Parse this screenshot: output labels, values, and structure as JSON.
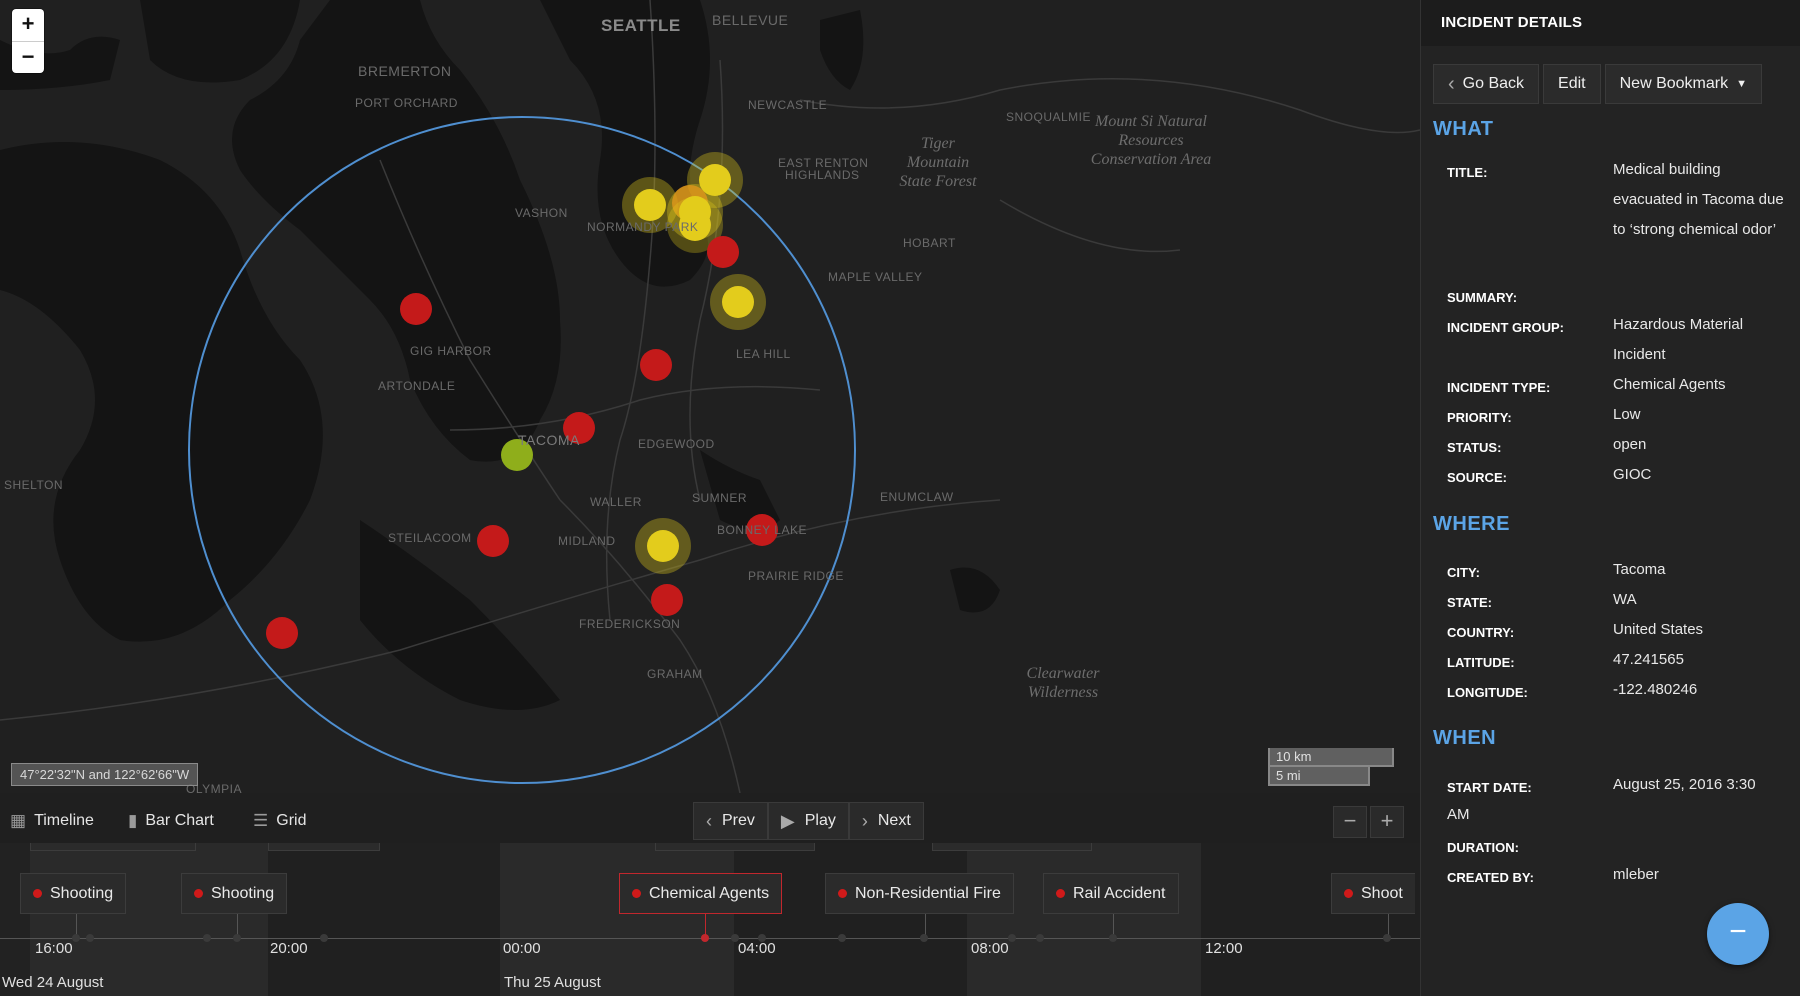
{
  "map": {
    "zoom_in": "+",
    "zoom_out": "−",
    "coordinates": "47°22'32\"N and 122°62'66\"W",
    "scale_km": "10 km",
    "scale_mi": "5 mi",
    "places": {
      "seattle": "SEATTLE",
      "bellevue": "BELLEVUE",
      "bremerton": "BREMERTON",
      "port_orchard": "PORT ORCHARD",
      "newcastle": "NEWCASTLE",
      "snoqualmie": "SNOQUALMIE",
      "east_renton": "EAST RENTON",
      "highlands": "HIGHLANDS",
      "vashon": "VASHON",
      "normandy_park": "NORMANDY PARK",
      "hobart": "HOBART",
      "maple_valley": "MAPLE VALLEY",
      "gig_harbor": "GIG HARBOR",
      "artondale": "ARTONDALE",
      "lea_hill": "LEA HILL",
      "tacoma": "TACOMA",
      "edgewood": "EDGEWOOD",
      "shelton": "SHELTON",
      "waller": "WALLER",
      "sumner": "SUMNER",
      "enumclaw": "ENUMCLAW",
      "bonney_lake": "BONNEY LAKE",
      "steilacoom": "STEILACOOM",
      "midland": "MIDLAND",
      "prairie_ridge": "PRAIRIE RIDGE",
      "frederickson": "FREDERICKSON",
      "graham": "GRAHAM",
      "olympia": "OLYMPIA",
      "tiger_mountain": "Tiger\nMountain\nState Forest",
      "mount_si": "Mount Si Natural\nResources\nConservation Area",
      "clearwater": "Clearwater\nWilderness"
    },
    "marker_colors": {
      "red": "#c41a1a",
      "yellow": "#e3cc1c",
      "green": "#8fae1b",
      "orange": "#e07a1a",
      "ring": "#4f8fd0"
    }
  },
  "timeline_bar": {
    "timeline_label": "Timeline",
    "barchart_label": "Bar Chart",
    "grid_label": "Grid",
    "prev_label": "Prev",
    "play_label": "Play",
    "next_label": "Next",
    "zoom_out": "−",
    "zoom_in": "+"
  },
  "timeline": {
    "events": [
      "Shooting",
      "Shooting",
      "Chemical Agents",
      "Non-Residential Fire",
      "Rail Accident",
      "Shoot"
    ],
    "ticks": [
      "16:00",
      "20:00",
      "00:00",
      "04:00",
      "08:00",
      "12:00"
    ],
    "dates": [
      "Wed 24 August",
      "Thu 25 August"
    ]
  },
  "panel": {
    "header": "INCIDENT DETAILS",
    "go_back": "Go Back",
    "edit": "Edit",
    "new_bookmark": "New Bookmark",
    "what": "WHAT",
    "where": "WHERE",
    "when": "WHEN",
    "title_k": "TITLE:",
    "title_v": "Medical building evacuated in Tacoma due to ‘strong chemical odor’",
    "summary_k": "SUMMARY:",
    "summary_v": "",
    "group_k": "INCIDENT GROUP:",
    "group_v": "Hazardous Material Incident",
    "type_k": "INCIDENT TYPE:",
    "type_v": "Chemical Agents",
    "priority_k": "PRIORITY:",
    "priority_v": "Low",
    "status_k": "STATUS:",
    "status_v": "open",
    "source_k": "SOURCE:",
    "source_v": "GIOC",
    "city_k": "CITY:",
    "city_v": "Tacoma",
    "state_k": "STATE:",
    "state_v": "WA",
    "country_k": "COUNTRY:",
    "country_v": "United States",
    "lat_k": "LATITUDE:",
    "lat_v": "47.241565",
    "lon_k": "LONGITUDE:",
    "lon_v": "-122.480246",
    "start_k": "START DATE:",
    "start_v": "August 25, 2016 3:30",
    "start_v2": "AM",
    "duration_k": "DURATION:",
    "duration_v": "",
    "created_k": "CREATED BY:",
    "created_v": "mleber",
    "fab": "−"
  }
}
